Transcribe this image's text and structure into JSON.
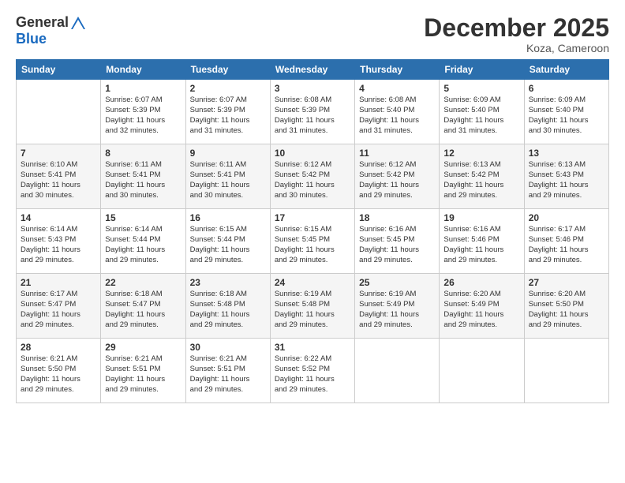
{
  "logo": {
    "general": "General",
    "blue": "Blue"
  },
  "header": {
    "month_year": "December 2025",
    "location": "Koza, Cameroon"
  },
  "weekdays": [
    "Sunday",
    "Monday",
    "Tuesday",
    "Wednesday",
    "Thursday",
    "Friday",
    "Saturday"
  ],
  "weeks": [
    [
      {
        "day": "",
        "info": ""
      },
      {
        "day": "1",
        "info": "Sunrise: 6:07 AM\nSunset: 5:39 PM\nDaylight: 11 hours\nand 32 minutes."
      },
      {
        "day": "2",
        "info": "Sunrise: 6:07 AM\nSunset: 5:39 PM\nDaylight: 11 hours\nand 31 minutes."
      },
      {
        "day": "3",
        "info": "Sunrise: 6:08 AM\nSunset: 5:39 PM\nDaylight: 11 hours\nand 31 minutes."
      },
      {
        "day": "4",
        "info": "Sunrise: 6:08 AM\nSunset: 5:40 PM\nDaylight: 11 hours\nand 31 minutes."
      },
      {
        "day": "5",
        "info": "Sunrise: 6:09 AM\nSunset: 5:40 PM\nDaylight: 11 hours\nand 31 minutes."
      },
      {
        "day": "6",
        "info": "Sunrise: 6:09 AM\nSunset: 5:40 PM\nDaylight: 11 hours\nand 30 minutes."
      }
    ],
    [
      {
        "day": "7",
        "info": ""
      },
      {
        "day": "8",
        "info": "Sunrise: 6:11 AM\nSunset: 5:41 PM\nDaylight: 11 hours\nand 30 minutes."
      },
      {
        "day": "9",
        "info": "Sunrise: 6:11 AM\nSunset: 5:41 PM\nDaylight: 11 hours\nand 30 minutes."
      },
      {
        "day": "10",
        "info": "Sunrise: 6:12 AM\nSunset: 5:42 PM\nDaylight: 11 hours\nand 30 minutes."
      },
      {
        "day": "11",
        "info": "Sunrise: 6:12 AM\nSunset: 5:42 PM\nDaylight: 11 hours\nand 29 minutes."
      },
      {
        "day": "12",
        "info": "Sunrise: 6:13 AM\nSunset: 5:42 PM\nDaylight: 11 hours\nand 29 minutes."
      },
      {
        "day": "13",
        "info": "Sunrise: 6:13 AM\nSunset: 5:43 PM\nDaylight: 11 hours\nand 29 minutes."
      }
    ],
    [
      {
        "day": "14",
        "info": ""
      },
      {
        "day": "15",
        "info": "Sunrise: 6:14 AM\nSunset: 5:44 PM\nDaylight: 11 hours\nand 29 minutes."
      },
      {
        "day": "16",
        "info": "Sunrise: 6:15 AM\nSunset: 5:44 PM\nDaylight: 11 hours\nand 29 minutes."
      },
      {
        "day": "17",
        "info": "Sunrise: 6:15 AM\nSunset: 5:45 PM\nDaylight: 11 hours\nand 29 minutes."
      },
      {
        "day": "18",
        "info": "Sunrise: 6:16 AM\nSunset: 5:45 PM\nDaylight: 11 hours\nand 29 minutes."
      },
      {
        "day": "19",
        "info": "Sunrise: 6:16 AM\nSunset: 5:46 PM\nDaylight: 11 hours\nand 29 minutes."
      },
      {
        "day": "20",
        "info": "Sunrise: 6:17 AM\nSunset: 5:46 PM\nDaylight: 11 hours\nand 29 minutes."
      }
    ],
    [
      {
        "day": "21",
        "info": ""
      },
      {
        "day": "22",
        "info": "Sunrise: 6:18 AM\nSunset: 5:47 PM\nDaylight: 11 hours\nand 29 minutes."
      },
      {
        "day": "23",
        "info": "Sunrise: 6:18 AM\nSunset: 5:48 PM\nDaylight: 11 hours\nand 29 minutes."
      },
      {
        "day": "24",
        "info": "Sunrise: 6:19 AM\nSunset: 5:48 PM\nDaylight: 11 hours\nand 29 minutes."
      },
      {
        "day": "25",
        "info": "Sunrise: 6:19 AM\nSunset: 5:49 PM\nDaylight: 11 hours\nand 29 minutes."
      },
      {
        "day": "26",
        "info": "Sunrise: 6:20 AM\nSunset: 5:49 PM\nDaylight: 11 hours\nand 29 minutes."
      },
      {
        "day": "27",
        "info": "Sunrise: 6:20 AM\nSunset: 5:50 PM\nDaylight: 11 hours\nand 29 minutes."
      }
    ],
    [
      {
        "day": "28",
        "info": "Sunrise: 6:21 AM\nSunset: 5:50 PM\nDaylight: 11 hours\nand 29 minutes."
      },
      {
        "day": "29",
        "info": "Sunrise: 6:21 AM\nSunset: 5:51 PM\nDaylight: 11 hours\nand 29 minutes."
      },
      {
        "day": "30",
        "info": "Sunrise: 6:21 AM\nSunset: 5:51 PM\nDaylight: 11 hours\nand 29 minutes."
      },
      {
        "day": "31",
        "info": "Sunrise: 6:22 AM\nSunset: 5:52 PM\nDaylight: 11 hours\nand 29 minutes."
      },
      {
        "day": "",
        "info": ""
      },
      {
        "day": "",
        "info": ""
      },
      {
        "day": "",
        "info": ""
      }
    ]
  ],
  "week1_row7_info": "Sunrise: 6:10 AM\nSunset: 5:41 PM\nDaylight: 11 hours\nand 30 minutes.",
  "week3_row14_info": "Sunrise: 6:14 AM\nSunset: 5:43 PM\nDaylight: 11 hours\nand 29 minutes.",
  "week4_row21_info": "Sunrise: 6:17 AM\nSunset: 5:47 PM\nDaylight: 11 hours\nand 29 minutes."
}
